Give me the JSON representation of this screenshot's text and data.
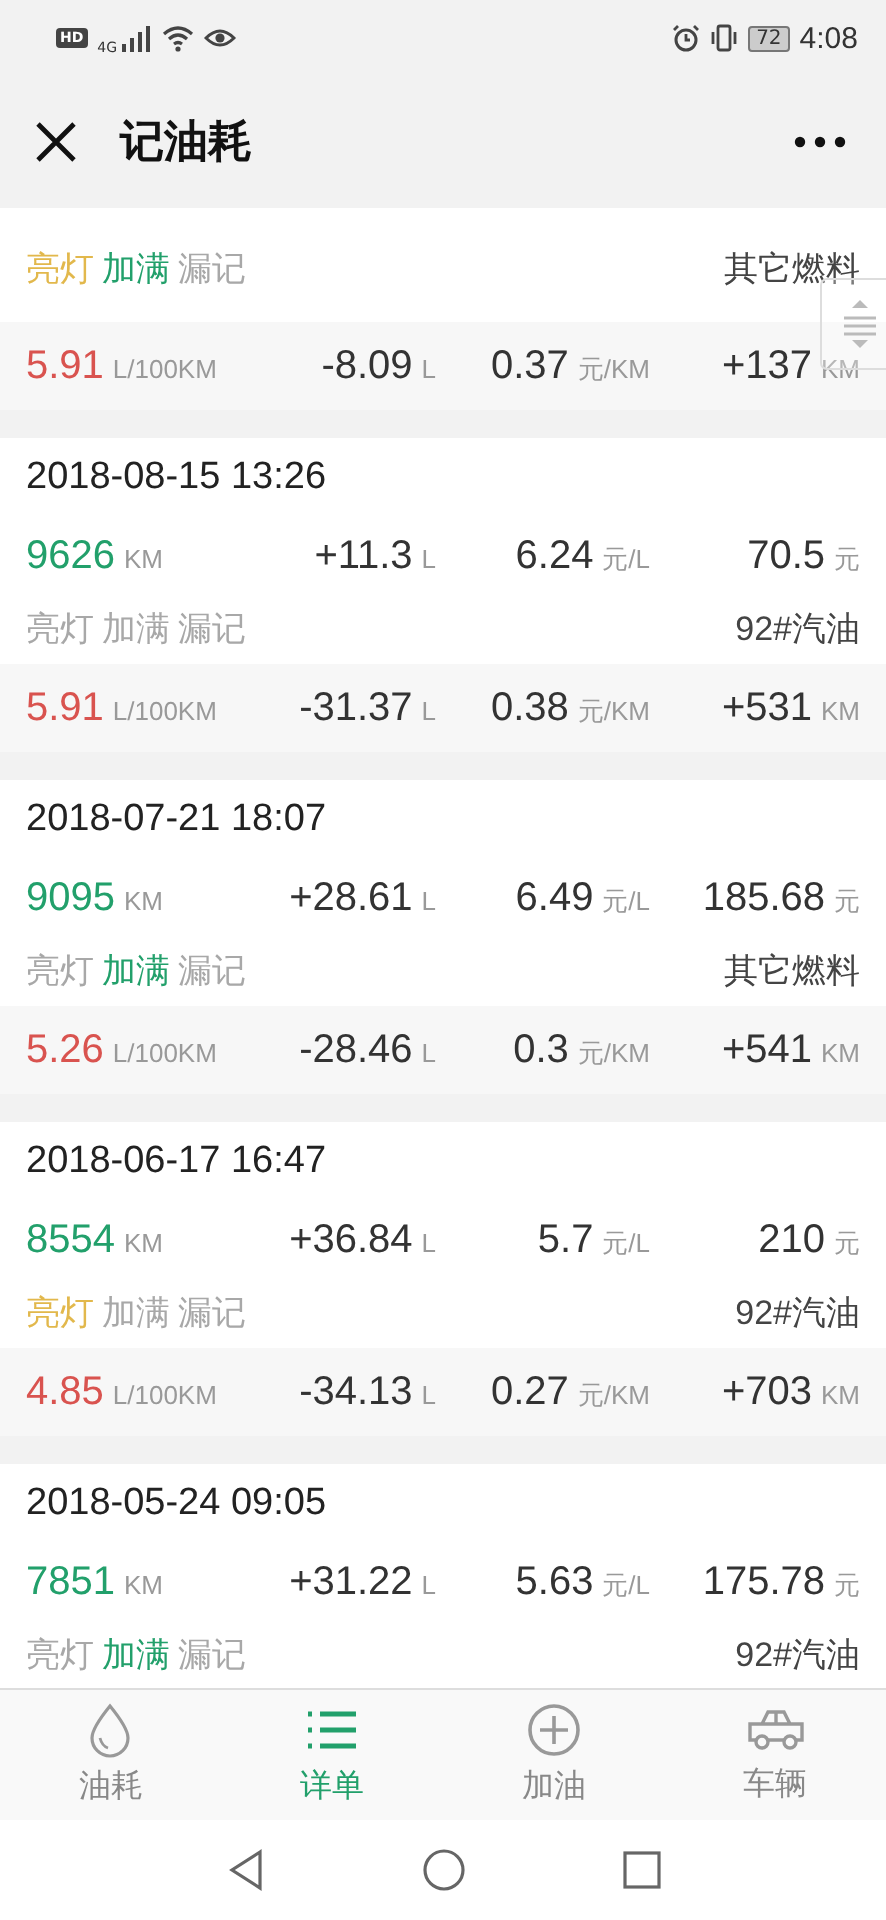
{
  "status_bar": {
    "hd": "HD",
    "network": "4G",
    "battery": "72",
    "time": "4:08"
  },
  "header": {
    "title": "记油耗"
  },
  "records": [
    {
      "tags": [
        {
          "kind": "light",
          "label": "亮灯",
          "on": true
        },
        {
          "kind": "full",
          "label": "加满",
          "on": true
        },
        {
          "kind": "missed",
          "label": "漏记",
          "on": false
        }
      ],
      "fuel_type": "其它燃料",
      "summary": {
        "consumption": {
          "value": "5.91",
          "unit": "L/100KM"
        },
        "fuel_diff": {
          "value": "-8.09",
          "unit": "L"
        },
        "cost_per_km": {
          "value": "0.37",
          "unit": "元/KM"
        },
        "distance": {
          "value": "+137",
          "unit": "KM"
        }
      }
    },
    {
      "date": "2018-08-15 13:26",
      "odometer": {
        "value": "9626",
        "unit": "KM"
      },
      "fuel_added": {
        "value": "+11.3",
        "unit": "L"
      },
      "unit_price": {
        "value": "6.24",
        "unit": "元/L"
      },
      "cost": {
        "value": "70.5",
        "unit": "元"
      },
      "tags": [
        {
          "kind": "light",
          "label": "亮灯",
          "on": false
        },
        {
          "kind": "full",
          "label": "加满",
          "on": false
        },
        {
          "kind": "missed",
          "label": "漏记",
          "on": false
        }
      ],
      "fuel_type": "92#汽油",
      "summary": {
        "consumption": {
          "value": "5.91",
          "unit": "L/100KM"
        },
        "fuel_diff": {
          "value": "-31.37",
          "unit": "L"
        },
        "cost_per_km": {
          "value": "0.38",
          "unit": "元/KM"
        },
        "distance": {
          "value": "+531",
          "unit": "KM"
        }
      }
    },
    {
      "date": "2018-07-21 18:07",
      "odometer": {
        "value": "9095",
        "unit": "KM"
      },
      "fuel_added": {
        "value": "+28.61",
        "unit": "L"
      },
      "unit_price": {
        "value": "6.49",
        "unit": "元/L"
      },
      "cost": {
        "value": "185.68",
        "unit": "元"
      },
      "tags": [
        {
          "kind": "light",
          "label": "亮灯",
          "on": false
        },
        {
          "kind": "full",
          "label": "加满",
          "on": true
        },
        {
          "kind": "missed",
          "label": "漏记",
          "on": false
        }
      ],
      "fuel_type": "其它燃料",
      "summary": {
        "consumption": {
          "value": "5.26",
          "unit": "L/100KM"
        },
        "fuel_diff": {
          "value": "-28.46",
          "unit": "L"
        },
        "cost_per_km": {
          "value": "0.3",
          "unit": "元/KM"
        },
        "distance": {
          "value": "+541",
          "unit": "KM"
        }
      }
    },
    {
      "date": "2018-06-17 16:47",
      "odometer": {
        "value": "8554",
        "unit": "KM"
      },
      "fuel_added": {
        "value": "+36.84",
        "unit": "L"
      },
      "unit_price": {
        "value": "5.7",
        "unit": "元/L"
      },
      "cost": {
        "value": "210",
        "unit": "元"
      },
      "tags": [
        {
          "kind": "light",
          "label": "亮灯",
          "on": true
        },
        {
          "kind": "full",
          "label": "加满",
          "on": false
        },
        {
          "kind": "missed",
          "label": "漏记",
          "on": false
        }
      ],
      "fuel_type": "92#汽油",
      "summary": {
        "consumption": {
          "value": "4.85",
          "unit": "L/100KM"
        },
        "fuel_diff": {
          "value": "-34.13",
          "unit": "L"
        },
        "cost_per_km": {
          "value": "0.27",
          "unit": "元/KM"
        },
        "distance": {
          "value": "+703",
          "unit": "KM"
        }
      }
    },
    {
      "date": "2018-05-24 09:05",
      "odometer": {
        "value": "7851",
        "unit": "KM"
      },
      "fuel_added": {
        "value": "+31.22",
        "unit": "L"
      },
      "unit_price": {
        "value": "5.63",
        "unit": "元/L"
      },
      "cost": {
        "value": "175.78",
        "unit": "元"
      },
      "tags": [
        {
          "kind": "light",
          "label": "亮灯",
          "on": false
        },
        {
          "kind": "full",
          "label": "加满",
          "on": true
        },
        {
          "kind": "missed",
          "label": "漏记",
          "on": false
        }
      ],
      "fuel_type": "92#汽油"
    }
  ],
  "tabs": [
    {
      "kind": "consumption",
      "label": "油耗",
      "selected": false
    },
    {
      "kind": "details",
      "label": "详单",
      "selected": true
    },
    {
      "kind": "refuel",
      "label": "加油",
      "selected": false
    },
    {
      "kind": "vehicle",
      "label": "车辆",
      "selected": false
    }
  ]
}
